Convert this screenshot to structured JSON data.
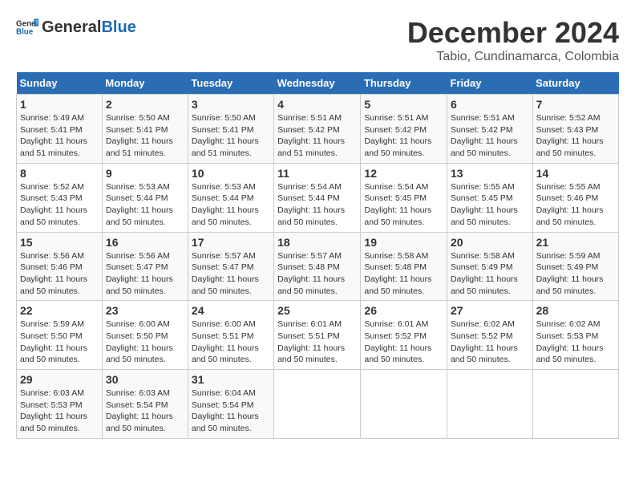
{
  "header": {
    "logo_general": "General",
    "logo_blue": "Blue",
    "title": "December 2024",
    "subtitle": "Tabio, Cundinamarca, Colombia"
  },
  "calendar": {
    "days_of_week": [
      "Sunday",
      "Monday",
      "Tuesday",
      "Wednesday",
      "Thursday",
      "Friday",
      "Saturday"
    ],
    "weeks": [
      [
        {
          "day": "1",
          "sunrise": "5:49 AM",
          "sunset": "5:41 PM",
          "daylight": "11 hours and 51 minutes."
        },
        {
          "day": "2",
          "sunrise": "5:50 AM",
          "sunset": "5:41 PM",
          "daylight": "11 hours and 51 minutes."
        },
        {
          "day": "3",
          "sunrise": "5:50 AM",
          "sunset": "5:41 PM",
          "daylight": "11 hours and 51 minutes."
        },
        {
          "day": "4",
          "sunrise": "5:51 AM",
          "sunset": "5:42 PM",
          "daylight": "11 hours and 51 minutes."
        },
        {
          "day": "5",
          "sunrise": "5:51 AM",
          "sunset": "5:42 PM",
          "daylight": "11 hours and 50 minutes."
        },
        {
          "day": "6",
          "sunrise": "5:51 AM",
          "sunset": "5:42 PM",
          "daylight": "11 hours and 50 minutes."
        },
        {
          "day": "7",
          "sunrise": "5:52 AM",
          "sunset": "5:43 PM",
          "daylight": "11 hours and 50 minutes."
        }
      ],
      [
        {
          "day": "8",
          "sunrise": "5:52 AM",
          "sunset": "5:43 PM",
          "daylight": "11 hours and 50 minutes."
        },
        {
          "day": "9",
          "sunrise": "5:53 AM",
          "sunset": "5:44 PM",
          "daylight": "11 hours and 50 minutes."
        },
        {
          "day": "10",
          "sunrise": "5:53 AM",
          "sunset": "5:44 PM",
          "daylight": "11 hours and 50 minutes."
        },
        {
          "day": "11",
          "sunrise": "5:54 AM",
          "sunset": "5:44 PM",
          "daylight": "11 hours and 50 minutes."
        },
        {
          "day": "12",
          "sunrise": "5:54 AM",
          "sunset": "5:45 PM",
          "daylight": "11 hours and 50 minutes."
        },
        {
          "day": "13",
          "sunrise": "5:55 AM",
          "sunset": "5:45 PM",
          "daylight": "11 hours and 50 minutes."
        },
        {
          "day": "14",
          "sunrise": "5:55 AM",
          "sunset": "5:46 PM",
          "daylight": "11 hours and 50 minutes."
        }
      ],
      [
        {
          "day": "15",
          "sunrise": "5:56 AM",
          "sunset": "5:46 PM",
          "daylight": "11 hours and 50 minutes."
        },
        {
          "day": "16",
          "sunrise": "5:56 AM",
          "sunset": "5:47 PM",
          "daylight": "11 hours and 50 minutes."
        },
        {
          "day": "17",
          "sunrise": "5:57 AM",
          "sunset": "5:47 PM",
          "daylight": "11 hours and 50 minutes."
        },
        {
          "day": "18",
          "sunrise": "5:57 AM",
          "sunset": "5:48 PM",
          "daylight": "11 hours and 50 minutes."
        },
        {
          "day": "19",
          "sunrise": "5:58 AM",
          "sunset": "5:48 PM",
          "daylight": "11 hours and 50 minutes."
        },
        {
          "day": "20",
          "sunrise": "5:58 AM",
          "sunset": "5:49 PM",
          "daylight": "11 hours and 50 minutes."
        },
        {
          "day": "21",
          "sunrise": "5:59 AM",
          "sunset": "5:49 PM",
          "daylight": "11 hours and 50 minutes."
        }
      ],
      [
        {
          "day": "22",
          "sunrise": "5:59 AM",
          "sunset": "5:50 PM",
          "daylight": "11 hours and 50 minutes."
        },
        {
          "day": "23",
          "sunrise": "6:00 AM",
          "sunset": "5:50 PM",
          "daylight": "11 hours and 50 minutes."
        },
        {
          "day": "24",
          "sunrise": "6:00 AM",
          "sunset": "5:51 PM",
          "daylight": "11 hours and 50 minutes."
        },
        {
          "day": "25",
          "sunrise": "6:01 AM",
          "sunset": "5:51 PM",
          "daylight": "11 hours and 50 minutes."
        },
        {
          "day": "26",
          "sunrise": "6:01 AM",
          "sunset": "5:52 PM",
          "daylight": "11 hours and 50 minutes."
        },
        {
          "day": "27",
          "sunrise": "6:02 AM",
          "sunset": "5:52 PM",
          "daylight": "11 hours and 50 minutes."
        },
        {
          "day": "28",
          "sunrise": "6:02 AM",
          "sunset": "5:53 PM",
          "daylight": "11 hours and 50 minutes."
        }
      ],
      [
        {
          "day": "29",
          "sunrise": "6:03 AM",
          "sunset": "5:53 PM",
          "daylight": "11 hours and 50 minutes."
        },
        {
          "day": "30",
          "sunrise": "6:03 AM",
          "sunset": "5:54 PM",
          "daylight": "11 hours and 50 minutes."
        },
        {
          "day": "31",
          "sunrise": "6:04 AM",
          "sunset": "5:54 PM",
          "daylight": "11 hours and 50 minutes."
        },
        null,
        null,
        null,
        null
      ]
    ]
  }
}
